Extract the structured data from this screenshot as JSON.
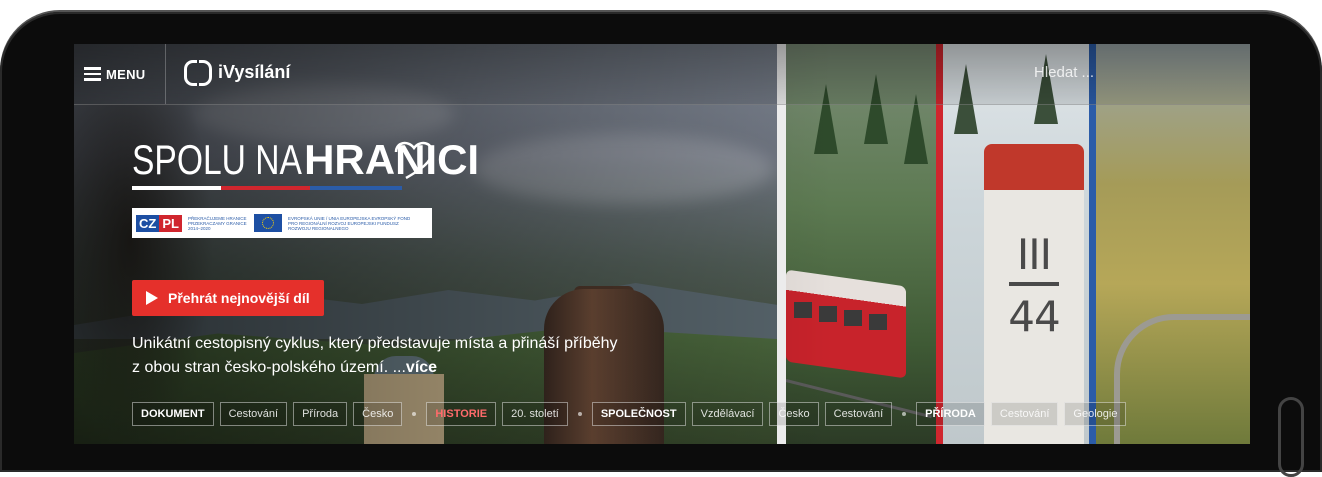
{
  "header": {
    "menu_label": "MENU",
    "logo_text": "iVysílání",
    "search_placeholder": "Hledat ..."
  },
  "hero": {
    "title_thin": "SPOLU NA",
    "title_bold": "HRANICI",
    "eu_logo": {
      "czpl_cz": "CZ",
      "czpl_pl": "PL",
      "program_text": "PŘEKRAČUJEME HRANICE PRZEKRACZAMY GRANICE 2014–2020",
      "eu_text": "EVROPSKÁ UNIE / UNIA EUROPEJSKA EVROPSKÝ FOND PRO REGIONÁLNÍ ROZVOJ EUROPEJSKI FUNDUSZ ROZWOJU REGIONALNEGO"
    },
    "play_label": "Přehrát nejnovější díl",
    "description_line1": "Unikátní cestopisný cyklus, který představuje místa a přináší příběhy",
    "description_line2": "z obou stran česko-polského území. ...",
    "more_label": "více",
    "boundary_post_top": "III",
    "boundary_post_bottom": "44"
  },
  "tags": [
    {
      "label": "DOKUMENT",
      "kind": "category"
    },
    {
      "label": "Cestování",
      "kind": "tag"
    },
    {
      "label": "Příroda",
      "kind": "tag"
    },
    {
      "label": "Česko",
      "kind": "tag"
    },
    {
      "label": "HISTORIE",
      "kind": "category-red"
    },
    {
      "label": "20. století",
      "kind": "tag"
    },
    {
      "label": "SPOLEČNOST",
      "kind": "category"
    },
    {
      "label": "Vzdělávací",
      "kind": "tag"
    },
    {
      "label": "Česko",
      "kind": "tag"
    },
    {
      "label": "Cestování",
      "kind": "tag"
    },
    {
      "label": "PŘÍRODA",
      "kind": "category"
    },
    {
      "label": "Cestování",
      "kind": "tag"
    },
    {
      "label": "Geologie",
      "kind": "tag"
    }
  ],
  "colors": {
    "accent_red": "#e5302b",
    "flag_red": "#d0262e",
    "flag_blue": "#2b5ca8"
  }
}
